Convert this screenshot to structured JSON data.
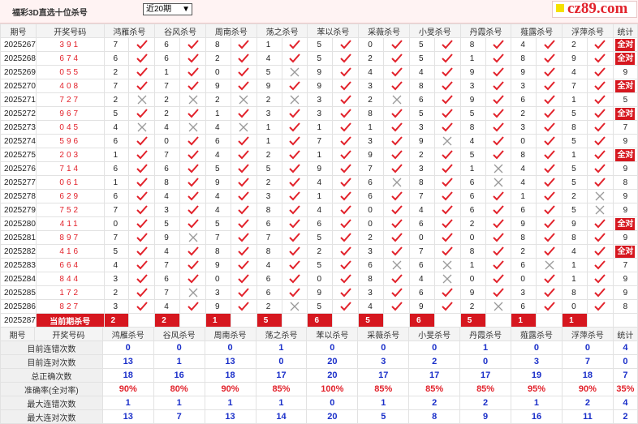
{
  "title": "福彩3D直选十位杀号",
  "period_select": {
    "value": "近20期",
    "icon": "chevron-down-icon"
  },
  "logo": {
    "text": "cz89.com",
    "color": "#e2222b"
  },
  "colors": {
    "accent": "#d6171f",
    "check": "#e2222b",
    "cross": "#999999",
    "stat_value": "#1a2fc9"
  },
  "columns": [
    "期号",
    "开奖号码",
    "鸿雁杀号",
    "谷风杀号",
    "周南杀号",
    "荡之杀号",
    "苯以杀号",
    "采薇杀号",
    "小旻杀号",
    "丹霞杀号",
    "薤露杀号",
    "浮萍杀号",
    "统计"
  ],
  "rows": [
    {
      "period": "2025267",
      "number": "391",
      "picks": [
        [
          7,
          "check"
        ],
        [
          6,
          "check"
        ],
        [
          8,
          "check"
        ],
        [
          1,
          "check"
        ],
        [
          5,
          "check"
        ],
        [
          0,
          "check"
        ],
        [
          5,
          "check"
        ],
        [
          8,
          "check"
        ],
        [
          4,
          "check"
        ],
        [
          2,
          "check"
        ]
      ],
      "stat": "全对"
    },
    {
      "period": "2025268",
      "number": "674",
      "picks": [
        [
          6,
          "check"
        ],
        [
          6,
          "check"
        ],
        [
          2,
          "check"
        ],
        [
          4,
          "check"
        ],
        [
          5,
          "check"
        ],
        [
          2,
          "check"
        ],
        [
          5,
          "check"
        ],
        [
          1,
          "check"
        ],
        [
          8,
          "check"
        ],
        [
          9,
          "check"
        ]
      ],
      "stat": "全对"
    },
    {
      "period": "2025269",
      "number": "055",
      "picks": [
        [
          2,
          "check"
        ],
        [
          1,
          "check"
        ],
        [
          0,
          "check"
        ],
        [
          5,
          "cross"
        ],
        [
          9,
          "check"
        ],
        [
          4,
          "check"
        ],
        [
          4,
          "check"
        ],
        [
          9,
          "check"
        ],
        [
          9,
          "check"
        ],
        [
          4,
          "check"
        ]
      ],
      "stat": "9"
    },
    {
      "period": "2025270",
      "number": "408",
      "picks": [
        [
          7,
          "check"
        ],
        [
          7,
          "check"
        ],
        [
          9,
          "check"
        ],
        [
          9,
          "check"
        ],
        [
          9,
          "check"
        ],
        [
          3,
          "check"
        ],
        [
          8,
          "check"
        ],
        [
          3,
          "check"
        ],
        [
          3,
          "check"
        ],
        [
          7,
          "check"
        ]
      ],
      "stat": "全对"
    },
    {
      "period": "2025271",
      "number": "727",
      "picks": [
        [
          2,
          "cross"
        ],
        [
          2,
          "cross"
        ],
        [
          2,
          "cross"
        ],
        [
          2,
          "cross"
        ],
        [
          3,
          "check"
        ],
        [
          2,
          "cross"
        ],
        [
          6,
          "check"
        ],
        [
          9,
          "check"
        ],
        [
          6,
          "check"
        ],
        [
          1,
          "check"
        ]
      ],
      "stat": "5"
    },
    {
      "period": "2025272",
      "number": "967",
      "picks": [
        [
          5,
          "check"
        ],
        [
          2,
          "check"
        ],
        [
          1,
          "check"
        ],
        [
          3,
          "check"
        ],
        [
          3,
          "check"
        ],
        [
          8,
          "check"
        ],
        [
          5,
          "check"
        ],
        [
          5,
          "check"
        ],
        [
          2,
          "check"
        ],
        [
          5,
          "check"
        ]
      ],
      "stat": "全对"
    },
    {
      "period": "2025273",
      "number": "045",
      "picks": [
        [
          4,
          "cross"
        ],
        [
          4,
          "cross"
        ],
        [
          4,
          "cross"
        ],
        [
          1,
          "check"
        ],
        [
          1,
          "check"
        ],
        [
          1,
          "check"
        ],
        [
          3,
          "check"
        ],
        [
          8,
          "check"
        ],
        [
          3,
          "check"
        ],
        [
          8,
          "check"
        ]
      ],
      "stat": "7"
    },
    {
      "period": "2025274",
      "number": "596",
      "picks": [
        [
          6,
          "check"
        ],
        [
          0,
          "check"
        ],
        [
          6,
          "check"
        ],
        [
          1,
          "check"
        ],
        [
          7,
          "check"
        ],
        [
          3,
          "check"
        ],
        [
          9,
          "cross"
        ],
        [
          4,
          "check"
        ],
        [
          0,
          "check"
        ],
        [
          5,
          "check"
        ]
      ],
      "stat": "9"
    },
    {
      "period": "2025275",
      "number": "203",
      "picks": [
        [
          1,
          "check"
        ],
        [
          7,
          "check"
        ],
        [
          4,
          "check"
        ],
        [
          2,
          "check"
        ],
        [
          1,
          "check"
        ],
        [
          9,
          "check"
        ],
        [
          2,
          "check"
        ],
        [
          5,
          "check"
        ],
        [
          8,
          "check"
        ],
        [
          1,
          "check"
        ]
      ],
      "stat": "全对"
    },
    {
      "period": "2025276",
      "number": "714",
      "picks": [
        [
          6,
          "check"
        ],
        [
          6,
          "check"
        ],
        [
          5,
          "check"
        ],
        [
          5,
          "check"
        ],
        [
          9,
          "check"
        ],
        [
          7,
          "check"
        ],
        [
          3,
          "check"
        ],
        [
          1,
          "cross"
        ],
        [
          4,
          "check"
        ],
        [
          5,
          "check"
        ]
      ],
      "stat": "9"
    },
    {
      "period": "2025277",
      "number": "061",
      "picks": [
        [
          1,
          "check"
        ],
        [
          8,
          "check"
        ],
        [
          9,
          "check"
        ],
        [
          2,
          "check"
        ],
        [
          4,
          "check"
        ],
        [
          6,
          "cross"
        ],
        [
          8,
          "check"
        ],
        [
          6,
          "cross"
        ],
        [
          4,
          "check"
        ],
        [
          5,
          "check"
        ]
      ],
      "stat": "8"
    },
    {
      "period": "2025278",
      "number": "629",
      "picks": [
        [
          6,
          "check"
        ],
        [
          4,
          "check"
        ],
        [
          4,
          "check"
        ],
        [
          3,
          "check"
        ],
        [
          1,
          "check"
        ],
        [
          6,
          "check"
        ],
        [
          7,
          "check"
        ],
        [
          6,
          "check"
        ],
        [
          1,
          "check"
        ],
        [
          2,
          "cross"
        ]
      ],
      "stat": "9"
    },
    {
      "period": "2025279",
      "number": "752",
      "picks": [
        [
          7,
          "check"
        ],
        [
          3,
          "check"
        ],
        [
          4,
          "check"
        ],
        [
          8,
          "check"
        ],
        [
          4,
          "check"
        ],
        [
          0,
          "check"
        ],
        [
          4,
          "check"
        ],
        [
          6,
          "check"
        ],
        [
          6,
          "check"
        ],
        [
          5,
          "cross"
        ]
      ],
      "stat": "9"
    },
    {
      "period": "2025280",
      "number": "411",
      "picks": [
        [
          0,
          "check"
        ],
        [
          5,
          "check"
        ],
        [
          5,
          "check"
        ],
        [
          6,
          "check"
        ],
        [
          6,
          "check"
        ],
        [
          0,
          "check"
        ],
        [
          6,
          "check"
        ],
        [
          2,
          "check"
        ],
        [
          9,
          "check"
        ],
        [
          9,
          "check"
        ]
      ],
      "stat": "全对"
    },
    {
      "period": "2025281",
      "number": "897",
      "picks": [
        [
          7,
          "check"
        ],
        [
          9,
          "cross"
        ],
        [
          7,
          "check"
        ],
        [
          7,
          "check"
        ],
        [
          5,
          "check"
        ],
        [
          2,
          "check"
        ],
        [
          0,
          "check"
        ],
        [
          0,
          "check"
        ],
        [
          8,
          "check"
        ],
        [
          8,
          "check"
        ]
      ],
      "stat": "9"
    },
    {
      "period": "2025282",
      "number": "416",
      "picks": [
        [
          5,
          "check"
        ],
        [
          4,
          "check"
        ],
        [
          8,
          "check"
        ],
        [
          8,
          "check"
        ],
        [
          2,
          "check"
        ],
        [
          3,
          "check"
        ],
        [
          7,
          "check"
        ],
        [
          8,
          "check"
        ],
        [
          2,
          "check"
        ],
        [
          4,
          "check"
        ]
      ],
      "stat": "全对"
    },
    {
      "period": "2025283",
      "number": "664",
      "picks": [
        [
          4,
          "check"
        ],
        [
          7,
          "check"
        ],
        [
          9,
          "check"
        ],
        [
          4,
          "check"
        ],
        [
          5,
          "check"
        ],
        [
          6,
          "cross"
        ],
        [
          6,
          "cross"
        ],
        [
          1,
          "check"
        ],
        [
          6,
          "cross"
        ],
        [
          1,
          "check"
        ]
      ],
      "stat": "7"
    },
    {
      "period": "2025284",
      "number": "844",
      "picks": [
        [
          3,
          "check"
        ],
        [
          6,
          "check"
        ],
        [
          0,
          "check"
        ],
        [
          6,
          "check"
        ],
        [
          0,
          "check"
        ],
        [
          8,
          "check"
        ],
        [
          4,
          "cross"
        ],
        [
          0,
          "check"
        ],
        [
          0,
          "check"
        ],
        [
          1,
          "check"
        ]
      ],
      "stat": "9"
    },
    {
      "period": "2025285",
      "number": "172",
      "picks": [
        [
          2,
          "check"
        ],
        [
          7,
          "cross"
        ],
        [
          3,
          "check"
        ],
        [
          6,
          "check"
        ],
        [
          9,
          "check"
        ],
        [
          3,
          "check"
        ],
        [
          6,
          "check"
        ],
        [
          9,
          "check"
        ],
        [
          3,
          "check"
        ],
        [
          8,
          "check"
        ]
      ],
      "stat": "9"
    },
    {
      "period": "2025286",
      "number": "827",
      "picks": [
        [
          3,
          "check"
        ],
        [
          4,
          "check"
        ],
        [
          9,
          "check"
        ],
        [
          2,
          "cross"
        ],
        [
          5,
          "check"
        ],
        [
          4,
          "check"
        ],
        [
          9,
          "check"
        ],
        [
          2,
          "cross"
        ],
        [
          6,
          "check"
        ],
        [
          0,
          "check"
        ]
      ],
      "stat": "8"
    }
  ],
  "current": {
    "period": "2025287",
    "label": "当前期杀号",
    "picks": [
      "2",
      "2",
      "1",
      "5",
      "6",
      "5",
      "6",
      "5",
      "1",
      "1"
    ]
  },
  "stats": [
    {
      "label": "目前连错次数",
      "values": [
        "0",
        "0",
        "0",
        "1",
        "0",
        "0",
        "0",
        "1",
        "0",
        "0"
      ],
      "total": "4"
    },
    {
      "label": "目前连对次数",
      "values": [
        "13",
        "1",
        "13",
        "0",
        "20",
        "3",
        "2",
        "0",
        "3",
        "7"
      ],
      "total": "0"
    },
    {
      "label": "总正确次数",
      "values": [
        "18",
        "16",
        "18",
        "17",
        "20",
        "17",
        "17",
        "17",
        "19",
        "18"
      ],
      "total": "7"
    },
    {
      "label": "准确率(全对率)",
      "values": [
        "90%",
        "80%",
        "90%",
        "85%",
        "100%",
        "85%",
        "85%",
        "85%",
        "95%",
        "90%"
      ],
      "total": "35%",
      "is_rate": true
    },
    {
      "label": "最大连错次数",
      "values": [
        "1",
        "1",
        "1",
        "1",
        "0",
        "1",
        "2",
        "2",
        "1",
        "2"
      ],
      "total": "4"
    },
    {
      "label": "最大连对次数",
      "values": [
        "13",
        "7",
        "13",
        "14",
        "20",
        "5",
        "8",
        "9",
        "16",
        "11"
      ],
      "total": "2"
    }
  ]
}
